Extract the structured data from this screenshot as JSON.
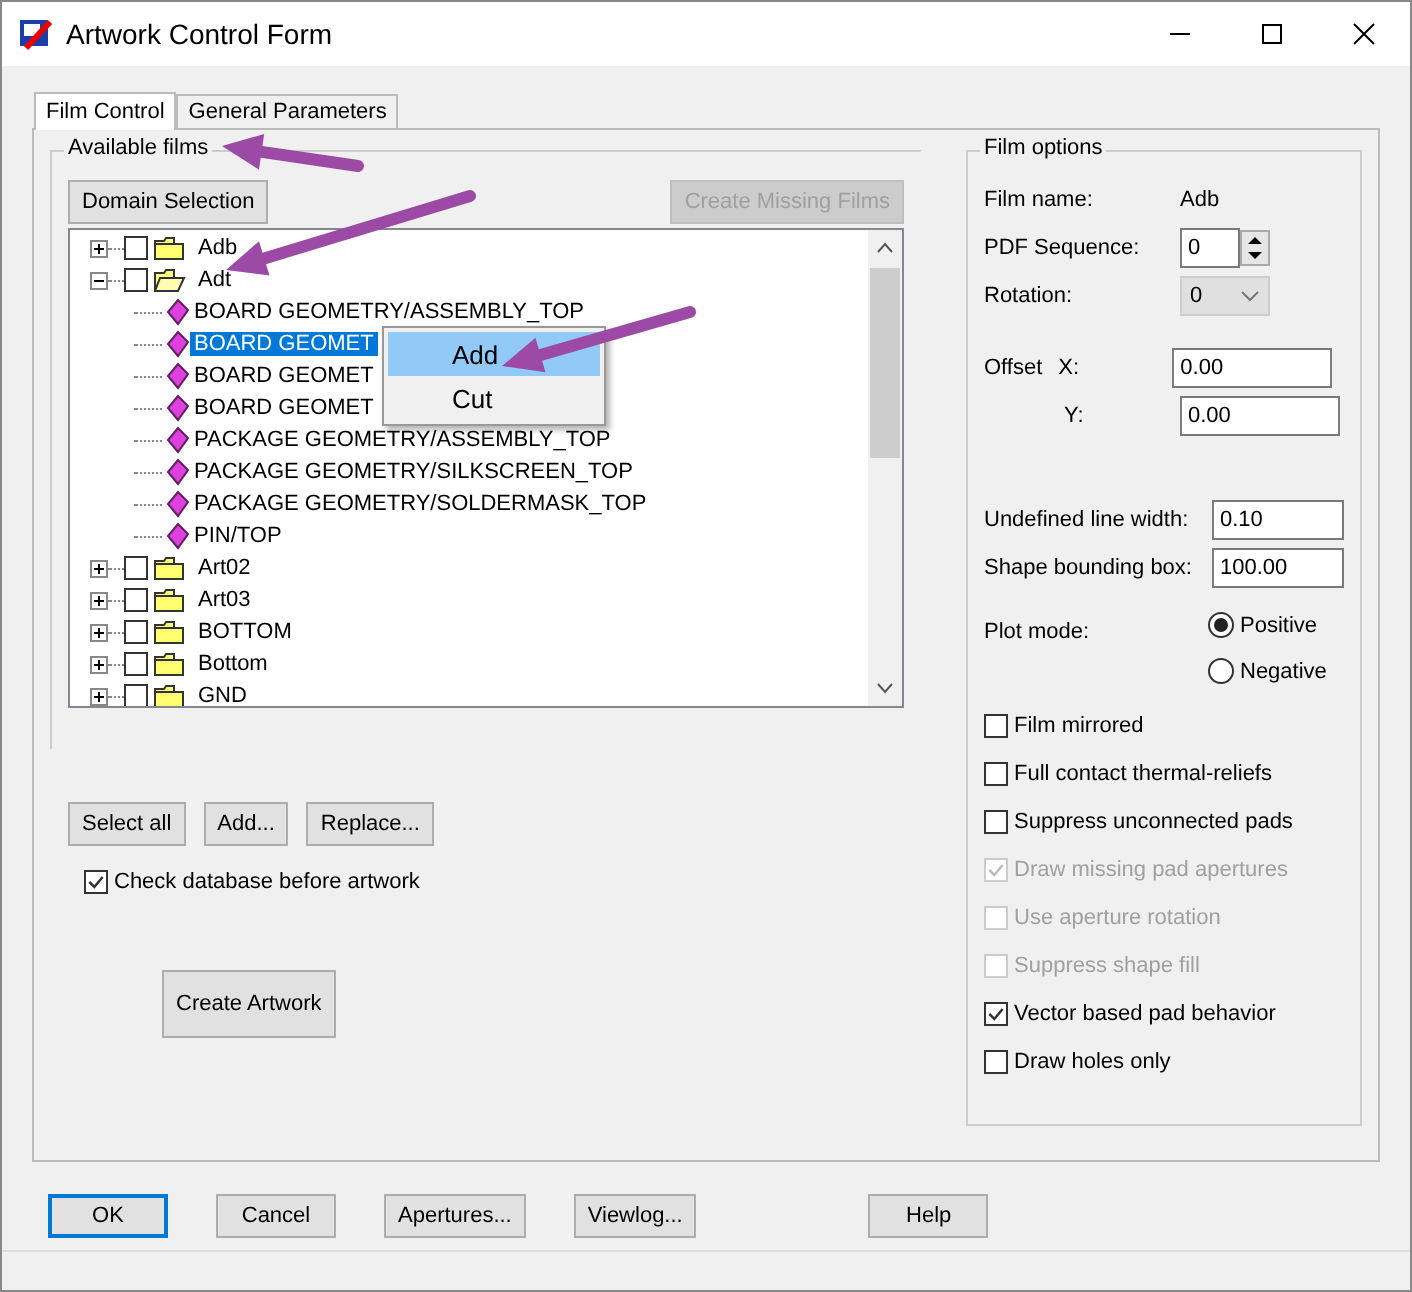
{
  "window": {
    "title": "Artwork Control Form"
  },
  "tabs": [
    {
      "label": "Film Control",
      "selected": true
    },
    {
      "label": "General Parameters",
      "selected": false
    }
  ],
  "available_films": {
    "title": "Available films",
    "domain_button": {
      "label": "Domain Selection",
      "disabled": false
    },
    "create_missing_button": {
      "label": "Create Missing Films",
      "disabled": true
    },
    "tree": [
      {
        "label": "Adb",
        "checked": false,
        "expanded": false
      },
      {
        "label": "Adt",
        "checked": false,
        "expanded": true,
        "children": [
          {
            "label": "BOARD GEOMETRY/ASSEMBLY_TOP",
            "selected": false
          },
          {
            "label": "BOARD GEOMET",
            "selected": true
          },
          {
            "label": "BOARD GEOMET",
            "selected": false
          },
          {
            "label": "BOARD GEOMET",
            "selected": false
          },
          {
            "label": "PACKAGE GEOMETRY/ASSEMBLY_TOP",
            "selected": false
          },
          {
            "label": "PACKAGE GEOMETRY/SILKSCREEN_TOP",
            "selected": false
          },
          {
            "label": "PACKAGE GEOMETRY/SOLDERMASK_TOP",
            "selected": false
          },
          {
            "label": "PIN/TOP",
            "selected": false
          }
        ]
      },
      {
        "label": "Art02",
        "checked": false,
        "expanded": false
      },
      {
        "label": "Art03",
        "checked": false,
        "expanded": false
      },
      {
        "label": "BOTTOM",
        "checked": false,
        "expanded": false
      },
      {
        "label": "Bottom",
        "checked": false,
        "expanded": false
      },
      {
        "label": "GND",
        "checked": false,
        "expanded": false
      }
    ],
    "buttons": [
      "Select all",
      "Add...",
      "Replace..."
    ],
    "check_database": {
      "label": "Check database before artwork",
      "checked": true
    },
    "create_artwork": "Create Artwork"
  },
  "context_menu": [
    {
      "label": "Add",
      "selected": true
    },
    {
      "label": "Cut",
      "selected": false
    }
  ],
  "film_options": {
    "title": "Film options",
    "film_name": {
      "label": "Film name:",
      "value": "Adb"
    },
    "pdf_sequence": {
      "label": "PDF Sequence:",
      "value": "0"
    },
    "rotation": {
      "label": "Rotation:",
      "value": "0",
      "disabled": true
    },
    "offset": {
      "label": "Offset",
      "x_label": "X:",
      "x_value": "0.00",
      "y_label": "Y:",
      "y_value": "0.00"
    },
    "undefined_line_width": {
      "label": "Undefined line width:",
      "value": "0.10"
    },
    "shape_bounding_box": {
      "label": "Shape bounding box:",
      "value": "100.00"
    },
    "plot_mode": {
      "label": "Plot mode:",
      "options": [
        {
          "label": "Positive",
          "selected": true
        },
        {
          "label": "Negative",
          "selected": false
        }
      ]
    },
    "checkboxes": [
      {
        "label": "Film mirrored",
        "checked": false,
        "disabled": false
      },
      {
        "label": "Full contact thermal-reliefs",
        "checked": false,
        "disabled": false
      },
      {
        "label": "Suppress unconnected pads",
        "checked": false,
        "disabled": false
      },
      {
        "label": "Draw missing pad apertures",
        "checked": true,
        "disabled": true
      },
      {
        "label": "Use aperture rotation",
        "checked": false,
        "disabled": true
      },
      {
        "label": "Suppress shape fill",
        "checked": false,
        "disabled": true
      },
      {
        "label": "Vector based pad behavior",
        "checked": true,
        "disabled": false
      },
      {
        "label": "Draw holes only",
        "checked": false,
        "disabled": false
      }
    ]
  },
  "buttons": [
    {
      "label": "OK",
      "default": true
    },
    {
      "label": "Cancel",
      "default": false
    },
    {
      "label": "Apertures...",
      "default": false
    },
    {
      "label": "Viewlog...",
      "default": false
    },
    {
      "label": "Help",
      "default": false
    }
  ]
}
